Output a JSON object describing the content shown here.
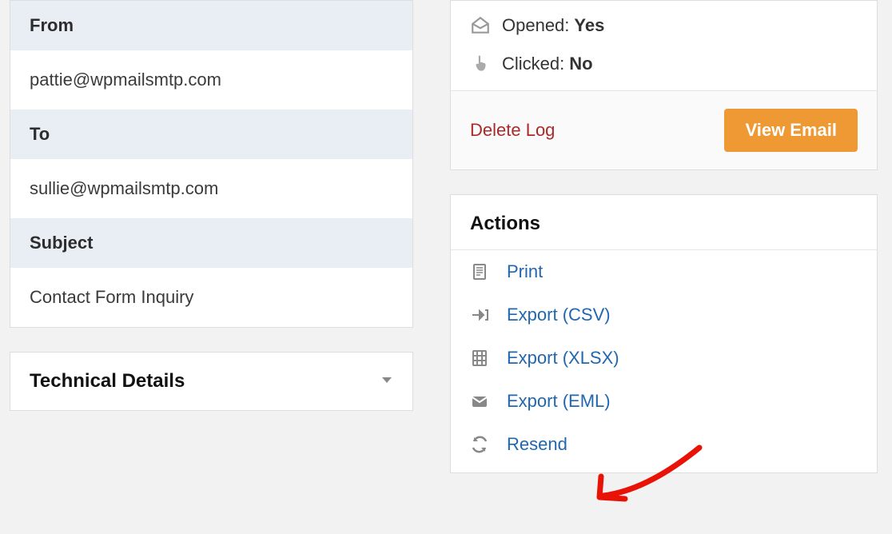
{
  "left": {
    "from_label": "From",
    "from_value": "pattie@wpmailsmtp.com",
    "to_label": "To",
    "to_value": "sullie@wpmailsmtp.com",
    "subject_label": "Subject",
    "subject_value": "Contact Form Inquiry",
    "technical_details_label": "Technical Details"
  },
  "right": {
    "opened_label": "Opened:",
    "opened_value": "Yes",
    "clicked_label": "Clicked:",
    "clicked_value": "No",
    "delete_log_label": "Delete Log",
    "view_email_label": "View Email",
    "actions_header": "Actions",
    "actions": [
      {
        "label": "Print"
      },
      {
        "label": "Export (CSV)"
      },
      {
        "label": "Export (XLSX)"
      },
      {
        "label": "Export (EML)"
      },
      {
        "label": "Resend"
      }
    ]
  }
}
